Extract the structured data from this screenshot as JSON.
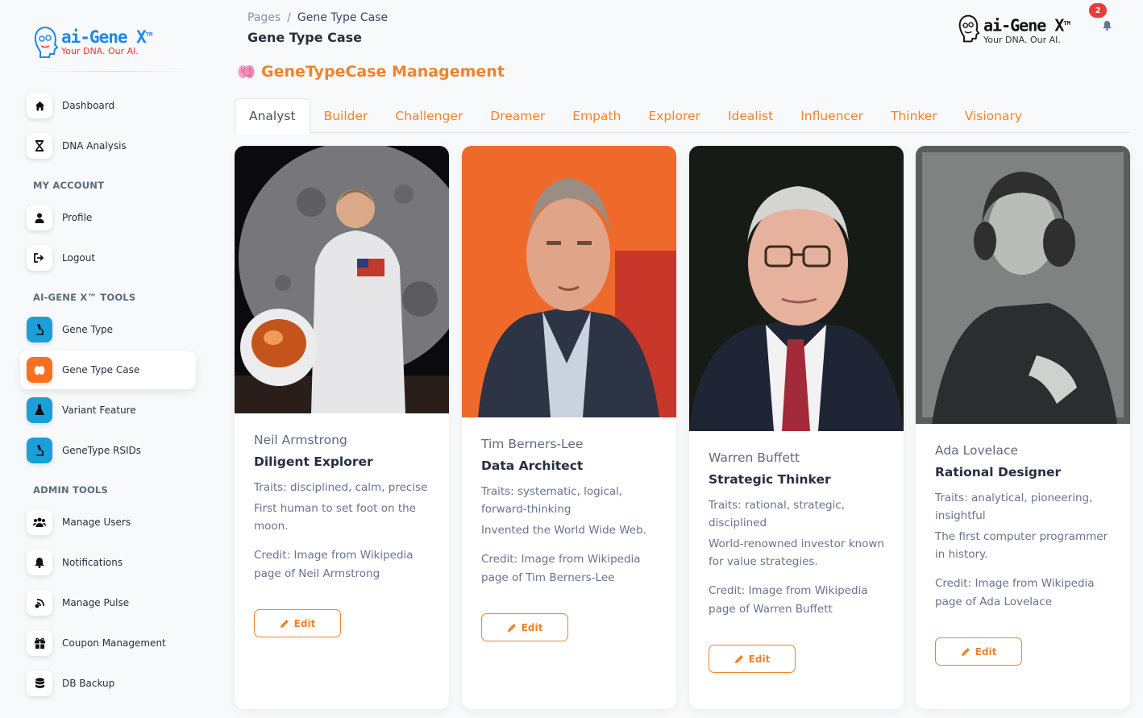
{
  "brand": {
    "name": "ai-Gene X",
    "tm": "TM",
    "tagline": "Your DNA. Our AI."
  },
  "sidebar": {
    "items_main": [
      {
        "label": "Dashboard",
        "icon": "home-icon"
      },
      {
        "label": "DNA Analysis",
        "icon": "dna-icon"
      }
    ],
    "section_account": "MY ACCOUNT",
    "items_account": [
      {
        "label": "Profile",
        "icon": "user-icon"
      },
      {
        "label": "Logout",
        "icon": "logout-icon"
      }
    ],
    "section_tools": "AI-GENE X™ TOOLS",
    "items_tools": [
      {
        "label": "Gene Type",
        "icon": "microscope-icon"
      },
      {
        "label": "Gene Type Case",
        "icon": "brain-icon",
        "active": true
      },
      {
        "label": "Variant Feature",
        "icon": "flask-icon"
      },
      {
        "label": "GeneType RSIDs",
        "icon": "microscope-icon"
      }
    ],
    "section_admin": "ADMIN TOOLS",
    "items_admin": [
      {
        "label": "Manage Users",
        "icon": "users-icon"
      },
      {
        "label": "Notifications",
        "icon": "bell-icon"
      },
      {
        "label": "Manage Pulse",
        "icon": "pulse-icon"
      },
      {
        "label": "Coupon Management",
        "icon": "gift-icon"
      },
      {
        "label": "DB Backup",
        "icon": "database-icon"
      }
    ]
  },
  "header": {
    "breadcrumb_root": "Pages",
    "breadcrumb_sep": "/",
    "breadcrumb_current": "Gene Type Case",
    "title": "Gene Type Case",
    "notification_count": "2"
  },
  "main": {
    "heading": "GeneTypeCase Management",
    "tabs": [
      "Analyst",
      "Builder",
      "Challenger",
      "Dreamer",
      "Empath",
      "Explorer",
      "Idealist",
      "Influencer",
      "Thinker",
      "Visionary"
    ],
    "active_tab": "Analyst",
    "edit_label": "Edit",
    "cards": [
      {
        "name": "Neil Armstrong",
        "title": "Diligent Explorer",
        "traits": "Traits: disciplined, calm, precise",
        "description": "First human to set foot on the moon.",
        "credit": "Credit: Image from Wikipedia page of Neil Armstrong"
      },
      {
        "name": "Tim Berners-Lee",
        "title": "Data Architect",
        "traits": "Traits: systematic, logical, forward-thinking",
        "description": "Invented the World Wide Web.",
        "credit": "Credit: Image from Wikipedia page of Tim Berners-Lee"
      },
      {
        "name": "Warren Buffett",
        "title": "Strategic Thinker",
        "traits": "Traits: rational, strategic, disciplined",
        "description": "World-renowned investor known for value strategies.",
        "credit": "Credit: Image from Wikipedia page of Warren Buffett"
      },
      {
        "name": "Ada Lovelace",
        "title": "Rational Designer",
        "traits": "Traits: analytical, pioneering, insightful",
        "description": "The first computer programmer in history.",
        "credit": "Credit: Image from Wikipedia page of Ada Lovelace"
      }
    ]
  },
  "colors": {
    "accent": "#f0832b",
    "active_icon": "#fb6f1e",
    "tool_icon": "#1a9fd8",
    "badge": "#ea3a3a"
  }
}
